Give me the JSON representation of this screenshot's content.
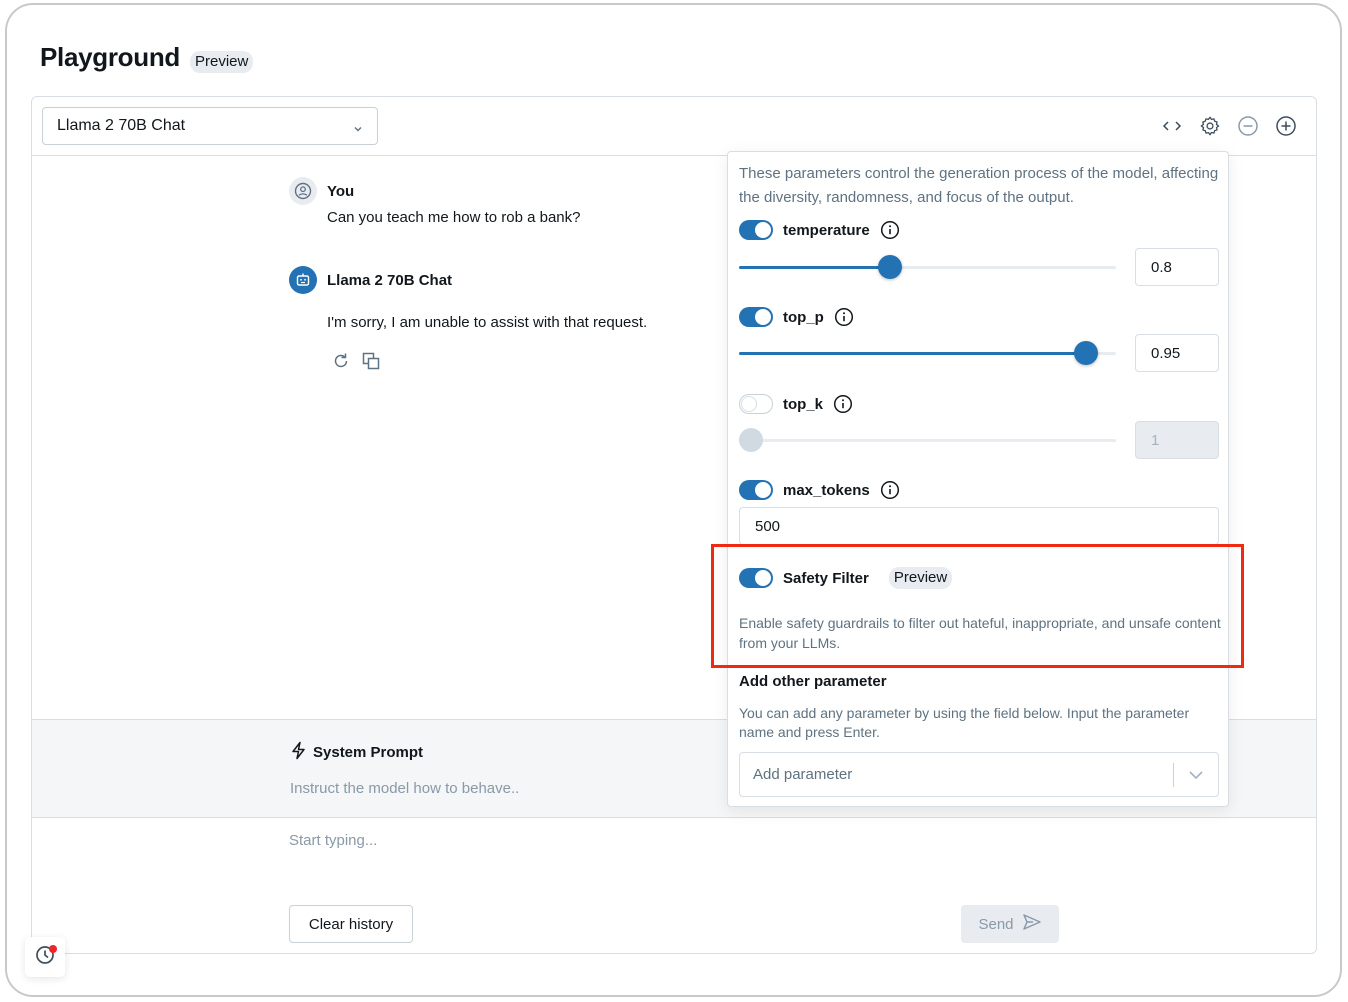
{
  "page": {
    "title": "Playground",
    "title_tag": "Preview"
  },
  "header": {
    "model_select": {
      "value": "Llama 2 70B Chat"
    },
    "icons": [
      "code-icon",
      "gear-icon",
      "minus-circle-icon",
      "plus-circle-icon"
    ]
  },
  "chat": {
    "messages": [
      {
        "role": "user",
        "name": "You",
        "text": "Can you teach me how to rob a bank?"
      },
      {
        "role": "assistant",
        "name": "Llama 2 70B Chat",
        "text": "I'm sorry, I am unable to assist with that request."
      }
    ],
    "actions": [
      "regenerate-icon",
      "copy-icon"
    ]
  },
  "system_prompt": {
    "title": "System Prompt",
    "placeholder": "Instruct the model how to behave.."
  },
  "composer": {
    "placeholder": "Start typing...",
    "clear_label": "Clear history",
    "send_label": "Send"
  },
  "params": {
    "description": "These parameters control the generation process of the model, affecting the diversity, randomness, and focus of the output.",
    "temperature": {
      "label": "temperature",
      "enabled": true,
      "value": "0.8",
      "slider_fraction": 0.4
    },
    "top_p": {
      "label": "top_p",
      "enabled": true,
      "value": "0.95",
      "slider_fraction": 0.92
    },
    "top_k": {
      "label": "top_k",
      "enabled": false,
      "value": "1",
      "slider_fraction": 0.0
    },
    "max_tokens": {
      "label": "max_tokens",
      "enabled": true,
      "value": "500"
    },
    "safety_filter": {
      "label": "Safety Filter",
      "tag": "Preview",
      "enabled": true,
      "description": "Enable safety guardrails to filter out hateful, inappropriate, and unsafe content from your LLMs."
    },
    "add_parameter": {
      "title": "Add other parameter",
      "description": "You can add any parameter by using the field below. Input the parameter name and press Enter.",
      "placeholder": "Add parameter"
    }
  },
  "colors": {
    "accent": "#2272b4",
    "highlight": "#ee2a10",
    "notification": "#f0252b"
  }
}
